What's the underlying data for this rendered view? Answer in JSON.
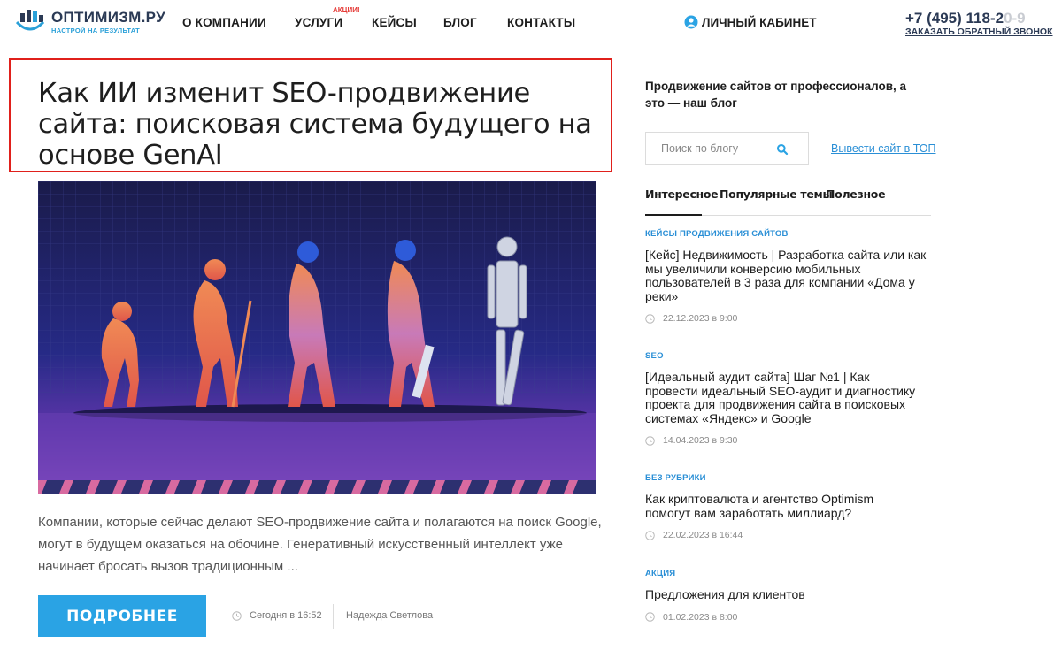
{
  "header": {
    "logo_name": "ОПТИМИЗМ.РУ",
    "logo_tagline": "НАСТРОЙ НА РЕЗУЛЬТАТ",
    "nav": [
      {
        "label": "О КОМПАНИИ"
      },
      {
        "label": "УСЛУГИ"
      },
      {
        "label": "КЕЙСЫ"
      },
      {
        "label": "БЛОГ"
      },
      {
        "label": "КОНТАКТЫ"
      }
    ],
    "promo_badge": "АКЦИИ!",
    "cabinet_label": "ЛИЧНЫЙ КАБИНЕТ",
    "phone_main": "+7 (495) 118-2",
    "phone_faded": "0-9",
    "callback_label": "ЗАКАЗАТЬ ОБРАТНЫЙ ЗВОНОК"
  },
  "article": {
    "title": "Как ИИ изменит SEO-продвижение сайта: поисковая система будущего на основе GenAI",
    "excerpt": "Компании, которые сейчас делают SEO-продвижение сайта и полагаются на поиск Google, могут в будущем оказаться на обочине. Генеративный искусственный интеллект уже начинает бросать вызов традиционным ...",
    "more_label": "ПОДРОБНЕЕ",
    "date": "Сегодня в 16:52",
    "author": "Надежда Светлова"
  },
  "sidebar": {
    "intro": "Продвижение сайтов от профессионалов, а это — наш блог",
    "search_placeholder": "Поиск по блогу",
    "top_link": "Вывести сайт в ТОП",
    "tabs": [
      {
        "label": "Интересное",
        "active": true
      },
      {
        "label": "Популярные темы",
        "active": false
      },
      {
        "label": "Полезное",
        "active": false
      }
    ],
    "posts": [
      {
        "category": "КЕЙСЫ ПРОДВИЖЕНИЯ САЙТОВ",
        "title": "[Кейс] Недвижимость | Разработка сайта или как мы увеличили конверсию мобильных пользователей в 3 раза для компании «Дома у реки»",
        "date": "22.12.2023 в 9:00"
      },
      {
        "category": "SEO",
        "title": "[Идеальный аудит сайта] Шаг №1 | Как провести идеальный SEO-аудит и диагностику проекта для продвижения сайта в поисковых системах «Яндекс» и Google",
        "date": "14.04.2023 в 9:30"
      },
      {
        "category": "БЕЗ РУБРИКИ",
        "title": "Как криптовалюта и агентство Optimism помогут вам заработать миллиард?",
        "date": "22.02.2023 в 16:44"
      },
      {
        "category": "АКЦИЯ",
        "title": "Предложения для клиентов",
        "date": "01.02.2023 в 8:00"
      }
    ]
  },
  "colors": {
    "brand_dark": "#2b3a55",
    "accent_blue": "#2aa3e4",
    "link_blue": "#2a8fd6",
    "highlight_red": "#e0201b",
    "promo_red": "#e53935"
  },
  "icons": {
    "logo": "logo-mark-icon",
    "cabinet": "user-circle-icon",
    "search": "search-icon",
    "clock": "clock-icon"
  }
}
